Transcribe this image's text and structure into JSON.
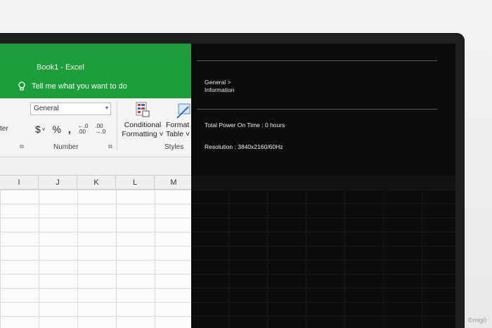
{
  "excel": {
    "title": "Book1  -  Excel",
    "tell_me": "Tell me what you want to do",
    "left_truncated_label": "ter",
    "number_format_value": "General",
    "number_buttons": {
      "currency": "$",
      "percent": "%",
      "comma": "̩",
      "increase_decimal": "←.0\n.00",
      "decrease_decimal": ".00\n→.0"
    },
    "groups": {
      "number": "Number",
      "styles": "Styles"
    },
    "conditional_formatting": "Conditional\nFormatting ˅",
    "format_as_table": "Format\nTable ˅",
    "columns": [
      "I",
      "J",
      "K",
      "L",
      "M"
    ]
  },
  "osd": {
    "breadcrumb_parent": "General >",
    "breadcrumb_current": "Information",
    "total_power_on_time": "Total Power On Time : 0 hours",
    "resolution": "Resolution  : 3840x2160/60Hz"
  },
  "watermark": "©mig0"
}
